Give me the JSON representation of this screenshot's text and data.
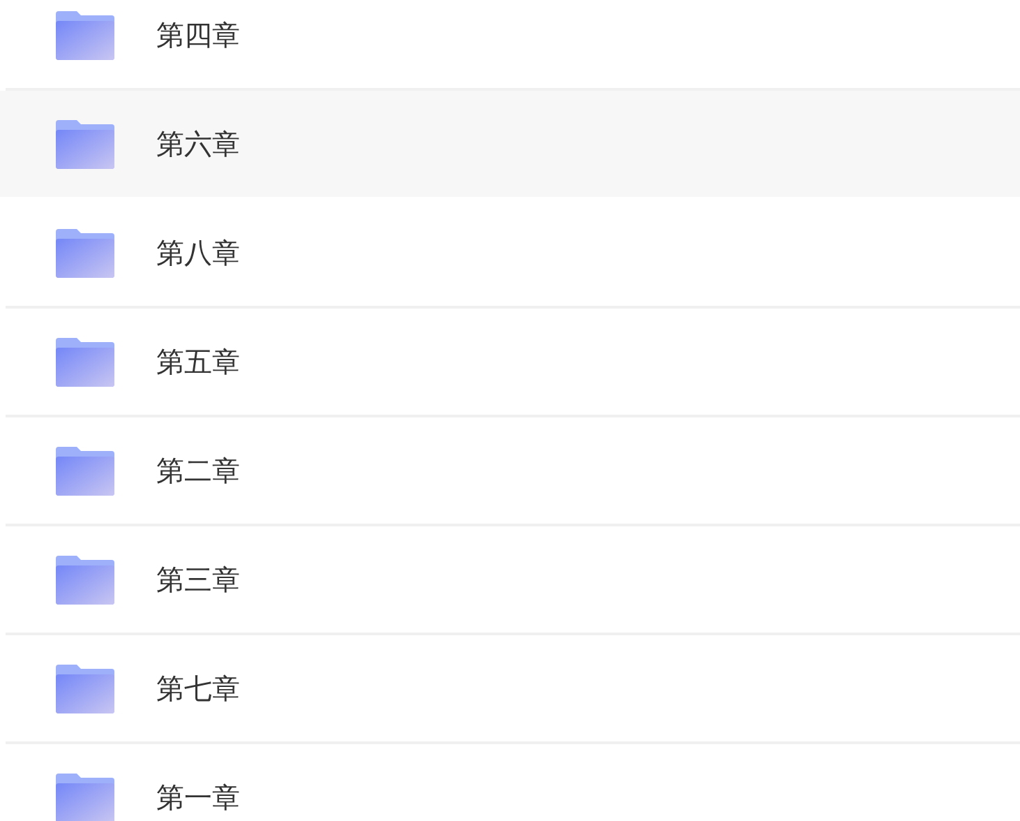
{
  "folders": [
    {
      "name": "第四章",
      "highlighted": false
    },
    {
      "name": "第六章",
      "highlighted": true
    },
    {
      "name": "第八章",
      "highlighted": false
    },
    {
      "name": "第五章",
      "highlighted": false
    },
    {
      "name": "第二章",
      "highlighted": false
    },
    {
      "name": "第三章",
      "highlighted": false
    },
    {
      "name": "第七章",
      "highlighted": false
    },
    {
      "name": "第一章",
      "highlighted": false
    }
  ]
}
